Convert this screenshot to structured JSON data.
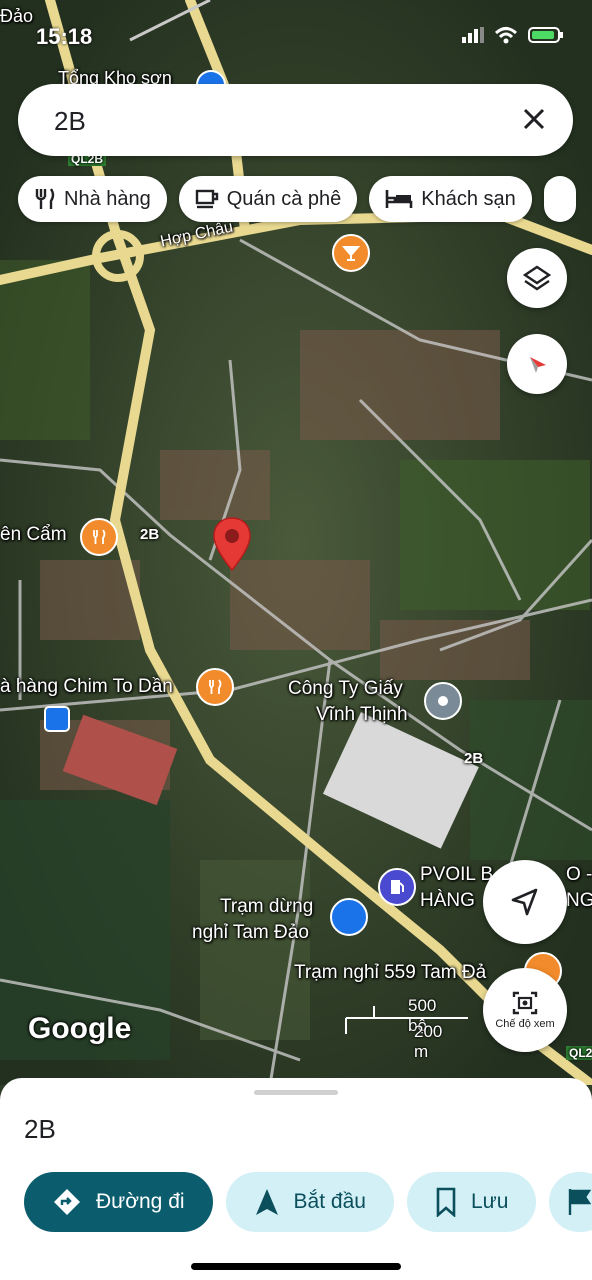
{
  "status_bar": {
    "time": "15:18"
  },
  "search": {
    "query": "2B"
  },
  "chips": [
    {
      "label": "Nhà hàng",
      "icon": "fork-knife-icon"
    },
    {
      "label": "Quán cà phê",
      "icon": "coffee-cup-icon"
    },
    {
      "label": "Khách sạn",
      "icon": "bed-icon"
    }
  ],
  "map_labels": {
    "corner_top": "Đảo",
    "tong_kho": "Tổng Kho sơn",
    "hop_chau": "Hợp Châu",
    "ql2b_top": "QL2B",
    "vien_cam": "ên Cẩm",
    "road_2b_left": "2B",
    "nha_hang_chim": "à hàng Chim To Dần",
    "cong_ty_1": "Công Ty Giấy",
    "cong_ty_2": "Vĩnh Thịnh",
    "road_2b_right": "2B",
    "pvoil_1": "PVOIL B",
    "pvoil_1b": "O -",
    "pvoil_2": "HÀNG",
    "pvoil_2b": "NG",
    "tram_dung_1": "Trạm dừng",
    "tram_dung_2": "nghỉ Tam Đảo",
    "tram_nghi": "Trạm nghỉ 559 Tam Đả",
    "ql2_bottom": "QL2",
    "google": "Google",
    "scale_ft": "500 bộ",
    "scale_m": "200 m"
  },
  "view_mode_label": "Chế độ xem",
  "sheet": {
    "title": "2B",
    "actions": [
      {
        "label": "Đường đi",
        "icon": "directions-icon"
      },
      {
        "label": "Bắt đầu",
        "icon": "navigation-arrow-icon"
      },
      {
        "label": "Lưu",
        "icon": "bookmark-icon"
      }
    ]
  },
  "colors": {
    "primary_action": "#0b5d6e",
    "secondary_action": "#d2f0f6",
    "highway": "#e8d890",
    "pin": "#e53935",
    "poi_orange": "#f28b2b",
    "poi_blue": "#1a73e8"
  }
}
